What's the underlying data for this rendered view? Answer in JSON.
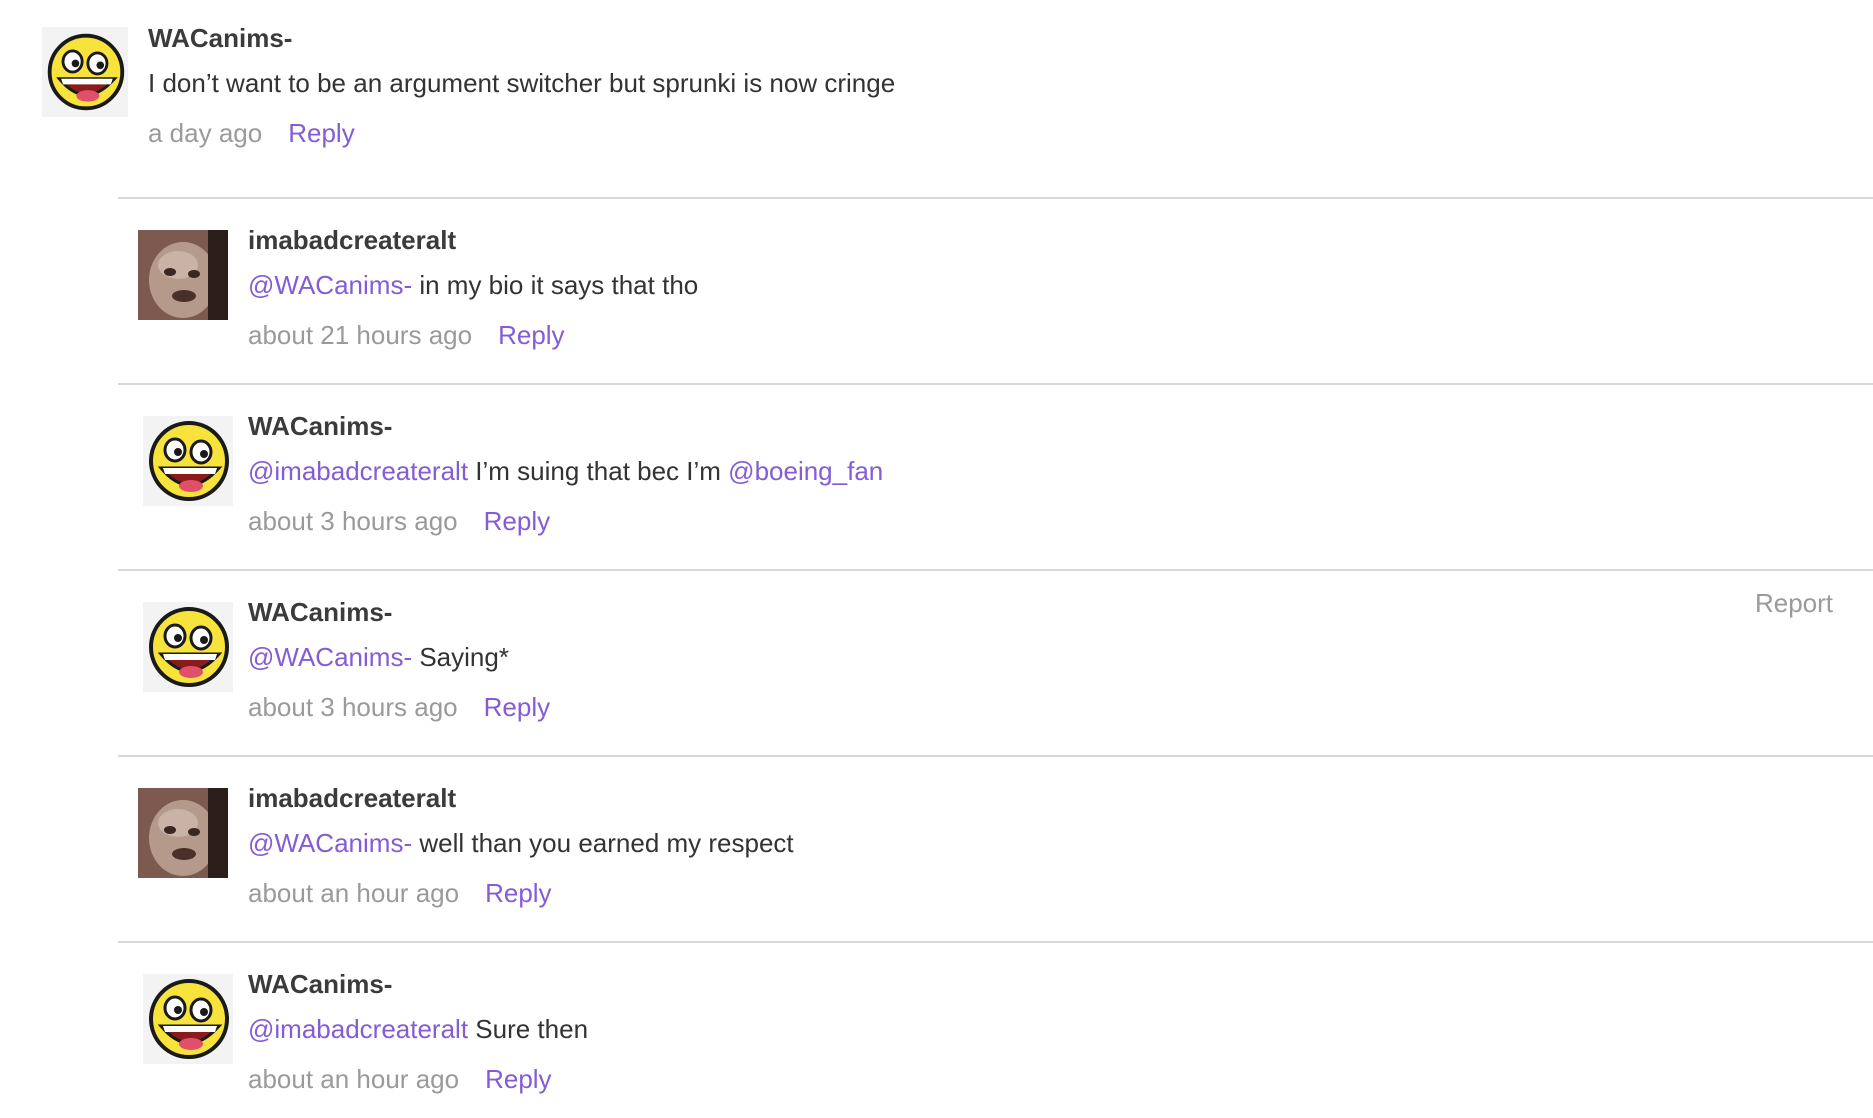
{
  "top_comment": {
    "username": "WACanims-",
    "text": "I don’t want to be an argument switcher but sprunki is now cringe",
    "time": "a day ago",
    "reply_label": "Reply"
  },
  "replies": [
    {
      "username": "imabadcreateralt",
      "mention": "@WACanims-",
      "text": " in my bio it says that tho",
      "time": "about 21 hours ago",
      "reply_label": "Reply"
    },
    {
      "username": "WACanims-",
      "mention": "@imabadcreateralt",
      "text": " I’m suing that bec I’m ",
      "mention2": "@boeing_fan",
      "time": "about 3 hours ago",
      "reply_label": "Reply"
    },
    {
      "username": "WACanims-",
      "mention": "@WACanims-",
      "text": " Saying*",
      "time": "about 3 hours ago",
      "reply_label": "Reply",
      "report_label": "Report"
    },
    {
      "username": "imabadcreateralt",
      "mention": "@WACanims-",
      "text": " well than you earned my respect",
      "time": "about an hour ago",
      "reply_label": "Reply"
    },
    {
      "username": "WACanims-",
      "mention": "@imabadcreateralt",
      "text": " Sure then",
      "time": "about an hour ago",
      "reply_label": "Reply"
    }
  ],
  "colors": {
    "link": "#855cd6",
    "muted": "#9a9a9a",
    "divider": "#d9d9d9"
  },
  "icons": {
    "awesome_face": "awesome-face-avatar",
    "photo_avatar": "photo-avatar"
  }
}
